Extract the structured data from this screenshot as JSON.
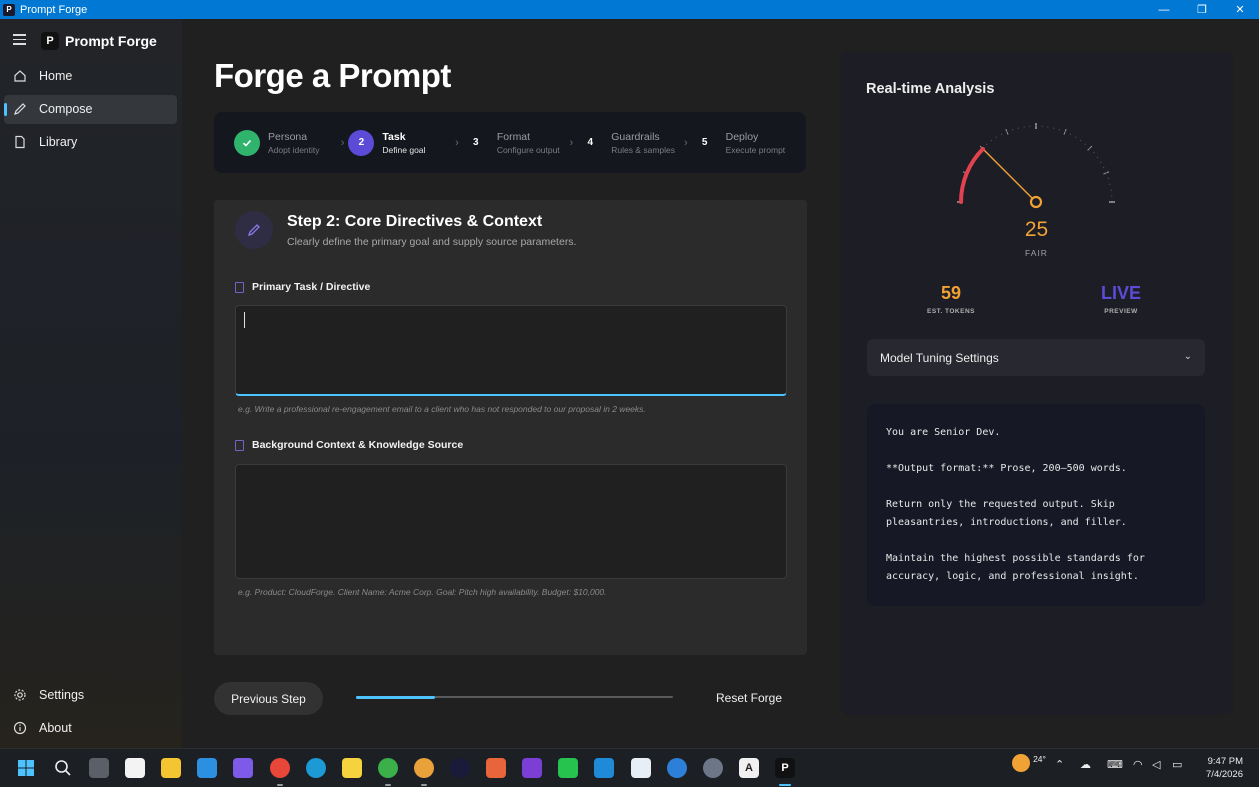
{
  "window": {
    "title": "Prompt Forge",
    "controls": {
      "minimize": "—",
      "maximize": "❐",
      "close": "✕"
    }
  },
  "sidebar": {
    "brand": "Prompt Forge",
    "brand_initial": "P",
    "items": [
      {
        "label": "Home",
        "icon": "home-icon"
      },
      {
        "label": "Compose",
        "icon": "pencil-icon",
        "active": true
      },
      {
        "label": "Library",
        "icon": "document-icon"
      }
    ],
    "footer": [
      {
        "label": "Settings",
        "icon": "gear-icon"
      },
      {
        "label": "About",
        "icon": "info-icon"
      }
    ]
  },
  "main": {
    "title": "Forge a Prompt",
    "steps": [
      {
        "num": "✓",
        "name": "Persona",
        "sub": "Adopt identity",
        "state": "done"
      },
      {
        "num": "2",
        "name": "Task",
        "sub": "Define goal",
        "state": "current"
      },
      {
        "num": "3",
        "name": "Format",
        "sub": "Configure output",
        "state": "future"
      },
      {
        "num": "4",
        "name": "Guardrails",
        "sub": "Rules & samples",
        "state": "future"
      },
      {
        "num": "5",
        "name": "Deploy",
        "sub": "Execute prompt",
        "state": "future"
      }
    ],
    "card": {
      "title": "Step 2: Core Directives & Context",
      "subtitle": "Clearly define the primary goal and supply source parameters.",
      "task_label": "Primary Task / Directive",
      "task_value": "",
      "task_hint": "e.g. Write a professional re-engagement email to a client who has not responded to our proposal in 2 weeks.",
      "context_label": "Background Context & Knowledge Source",
      "context_value": "",
      "context_hint": "e.g. Product: CloudForge. Client Name: Acme Corp. Goal: Pitch high availability. Budget: $10,000."
    },
    "prev_label": "Previous Step",
    "reset_label": "Reset Forge",
    "progress": 0.25
  },
  "analysis": {
    "title": "Real-time Analysis",
    "score": "25",
    "score_value": 25,
    "score_label": "FAIR",
    "tokens": "59",
    "tokens_label": "EST. TOKENS",
    "live": "LIVE",
    "live_label": "PREVIEW",
    "tuning_label": "Model Tuning Settings",
    "preview_lines": [
      "You are Senior Dev.",
      "**Output format:** Prose, 200–500 words.",
      "Return only the requested output. Skip pleasantries, introductions, and filler.",
      "Maintain the highest possible standards for accuracy, logic, and professional insight."
    ],
    "colors": {
      "score": "#f0a235",
      "gauge_red": "#e0424f",
      "live": "#5b4bd6"
    }
  },
  "taskbar": {
    "weather": "24°",
    "time": "9:47 PM",
    "date": "7/4/2026"
  }
}
